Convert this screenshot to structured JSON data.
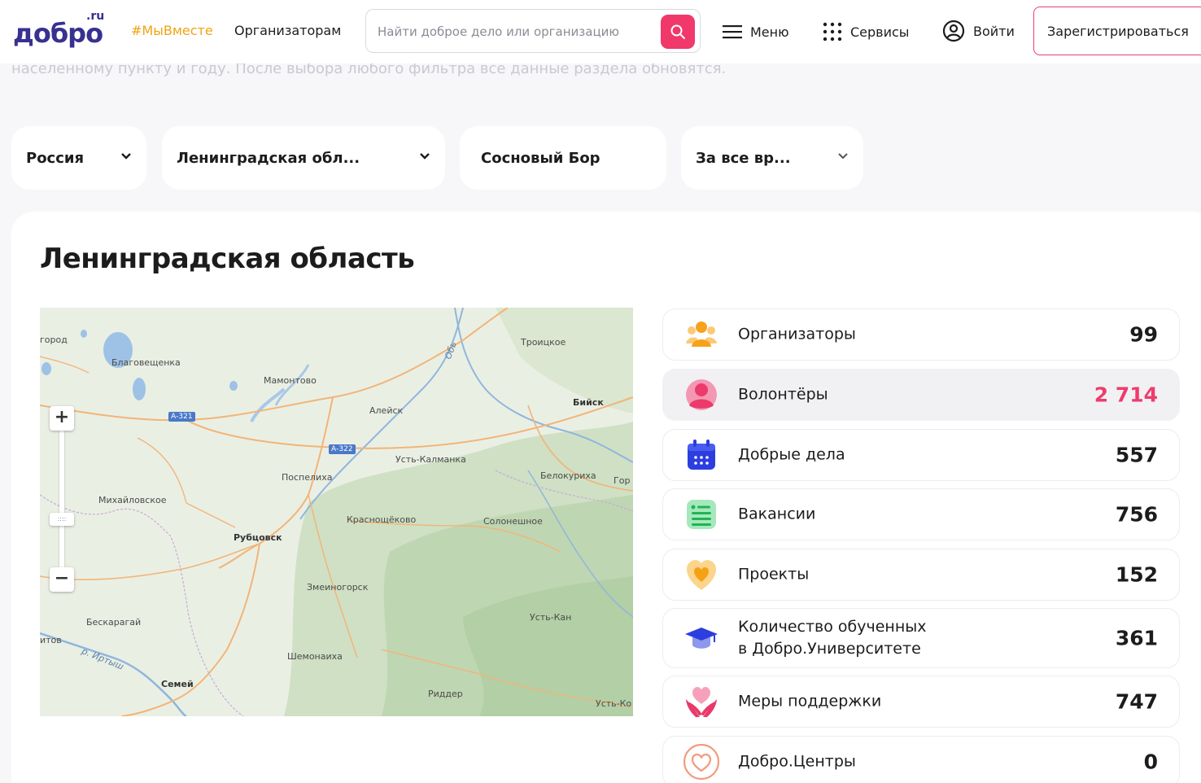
{
  "header": {
    "logo_word": "добро",
    "logo_ru": ".ru",
    "tag": "#МыВместе",
    "organizers_link": "Организаторам",
    "search_placeholder": "Найти доброе дело или организацию",
    "menu_label": "Меню",
    "services_label": "Сервисы",
    "login_label": "Войти",
    "register_label": "Зарегистрироваться"
  },
  "behind_text": "населенному пункту и году. После выбора любого фильтра все данные раздела обновятся.",
  "filters": {
    "country": "Россия",
    "region": "Ленинградская обл...",
    "city": "Сосновый Бор",
    "period": "За все вр..."
  },
  "region_title": "Ленинградская область",
  "map": {
    "zoom_in": "+",
    "zoom_out": "−",
    "labels": [
      {
        "text": "город",
        "kind": "normal"
      },
      {
        "text": "Благовещенка",
        "kind": "normal"
      },
      {
        "text": "Мамонтово",
        "kind": "normal"
      },
      {
        "text": "Троицкое",
        "kind": "normal"
      },
      {
        "text": "Бийск",
        "kind": "bold"
      },
      {
        "text": "Алейск",
        "kind": "normal"
      },
      {
        "text": "Усть-Калманка",
        "kind": "normal"
      },
      {
        "text": "Поспелиха",
        "kind": "normal"
      },
      {
        "text": "Белокуриха",
        "kind": "normal"
      },
      {
        "text": "Гор",
        "kind": "normal"
      },
      {
        "text": "Михайловское",
        "kind": "normal"
      },
      {
        "text": "Краснощёково",
        "kind": "normal"
      },
      {
        "text": "Солонешное",
        "kind": "normal"
      },
      {
        "text": "Рубцовск",
        "kind": "bold"
      },
      {
        "text": "Змеиногорск",
        "kind": "normal"
      },
      {
        "text": "Бескарагай",
        "kind": "normal"
      },
      {
        "text": "Усть-Кан",
        "kind": "normal"
      },
      {
        "text": "итов",
        "kind": "normal"
      },
      {
        "text": "р. Иртыш",
        "kind": "river"
      },
      {
        "text": "Шемонаиха",
        "kind": "normal"
      },
      {
        "text": "Семей",
        "kind": "bold"
      },
      {
        "text": "Риддер",
        "kind": "normal"
      },
      {
        "text": "Усть-Ко",
        "kind": "normal"
      },
      {
        "text": "Обь",
        "kind": "river"
      }
    ],
    "roads": [
      "А-321",
      "А-322"
    ]
  },
  "stats": [
    {
      "label": "Организаторы",
      "value": "99",
      "icon": "organizers-icon"
    },
    {
      "label": "Волонтёры",
      "value": "2 714",
      "icon": "volunteer-icon"
    },
    {
      "label": "Добрые дела",
      "value": "557",
      "icon": "calendar-icon"
    },
    {
      "label": "Вакансии",
      "value": "756",
      "icon": "list-icon"
    },
    {
      "label": "Проекты",
      "value": "152",
      "icon": "heart-icon"
    },
    {
      "label": "Количество обученных\nв Добро.Университете",
      "value": "361",
      "icon": "graduation-cap-icon"
    },
    {
      "label": "Меры поддержки",
      "value": "747",
      "icon": "hands-heart-icon"
    },
    {
      "label": "Добро.Центры",
      "value": "0",
      "icon": "heart-outline-icon"
    }
  ],
  "colors": {
    "brand": "#38318f",
    "accent_pink": "#f0386b",
    "tag_orange": "#f0a312"
  }
}
